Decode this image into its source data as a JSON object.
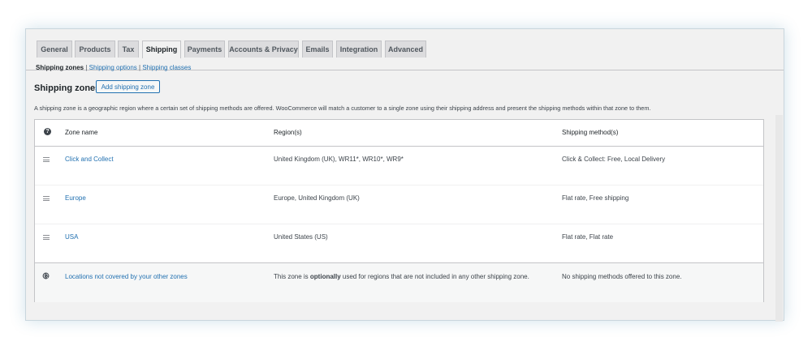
{
  "tabs": [
    {
      "label": "General"
    },
    {
      "label": "Products"
    },
    {
      "label": "Tax"
    },
    {
      "label": "Shipping"
    },
    {
      "label": "Payments"
    },
    {
      "label": "Accounts & Privacy"
    },
    {
      "label": "Emails"
    },
    {
      "label": "Integration"
    },
    {
      "label": "Advanced"
    }
  ],
  "subnav": {
    "current": "Shipping zones",
    "sep1": " | ",
    "options": "Shipping options",
    "sep2": " | ",
    "classes": "Shipping classes"
  },
  "section": {
    "title": "Shipping zones",
    "add_button": "Add shipping zone",
    "description": "A shipping zone is a geographic region where a certain set of shipping methods are offered. WooCommerce will match a customer to a single zone using their shipping address and present the shipping methods within that zone to them."
  },
  "table": {
    "headers": {
      "help_icon": "?",
      "zone": "Zone name",
      "regions": "Region(s)",
      "methods": "Shipping method(s)"
    },
    "rows": [
      {
        "zone": "Click and Collect",
        "regions": "United Kingdom (UK), WR11*, WR10*, WR9*",
        "methods": "Click & Collect: Free, Local Delivery"
      },
      {
        "zone": "Europe",
        "regions": "Europe, United Kingdom (UK)",
        "methods": "Flat rate, Free shipping"
      },
      {
        "zone": "USA",
        "regions": "United States (US)",
        "methods": "Flat rate, Flat rate"
      }
    ],
    "fallback": {
      "zone": "Locations not covered by your other zones",
      "regions_pre": "This zone is ",
      "regions_bold": "optionally",
      "regions_post": " used for regions that are not included in any other shipping zone.",
      "methods": "No shipping methods offered to this zone."
    }
  },
  "colors": {
    "link": "#2271b1",
    "text": "#3c434a",
    "background": "#f1f1f1"
  }
}
